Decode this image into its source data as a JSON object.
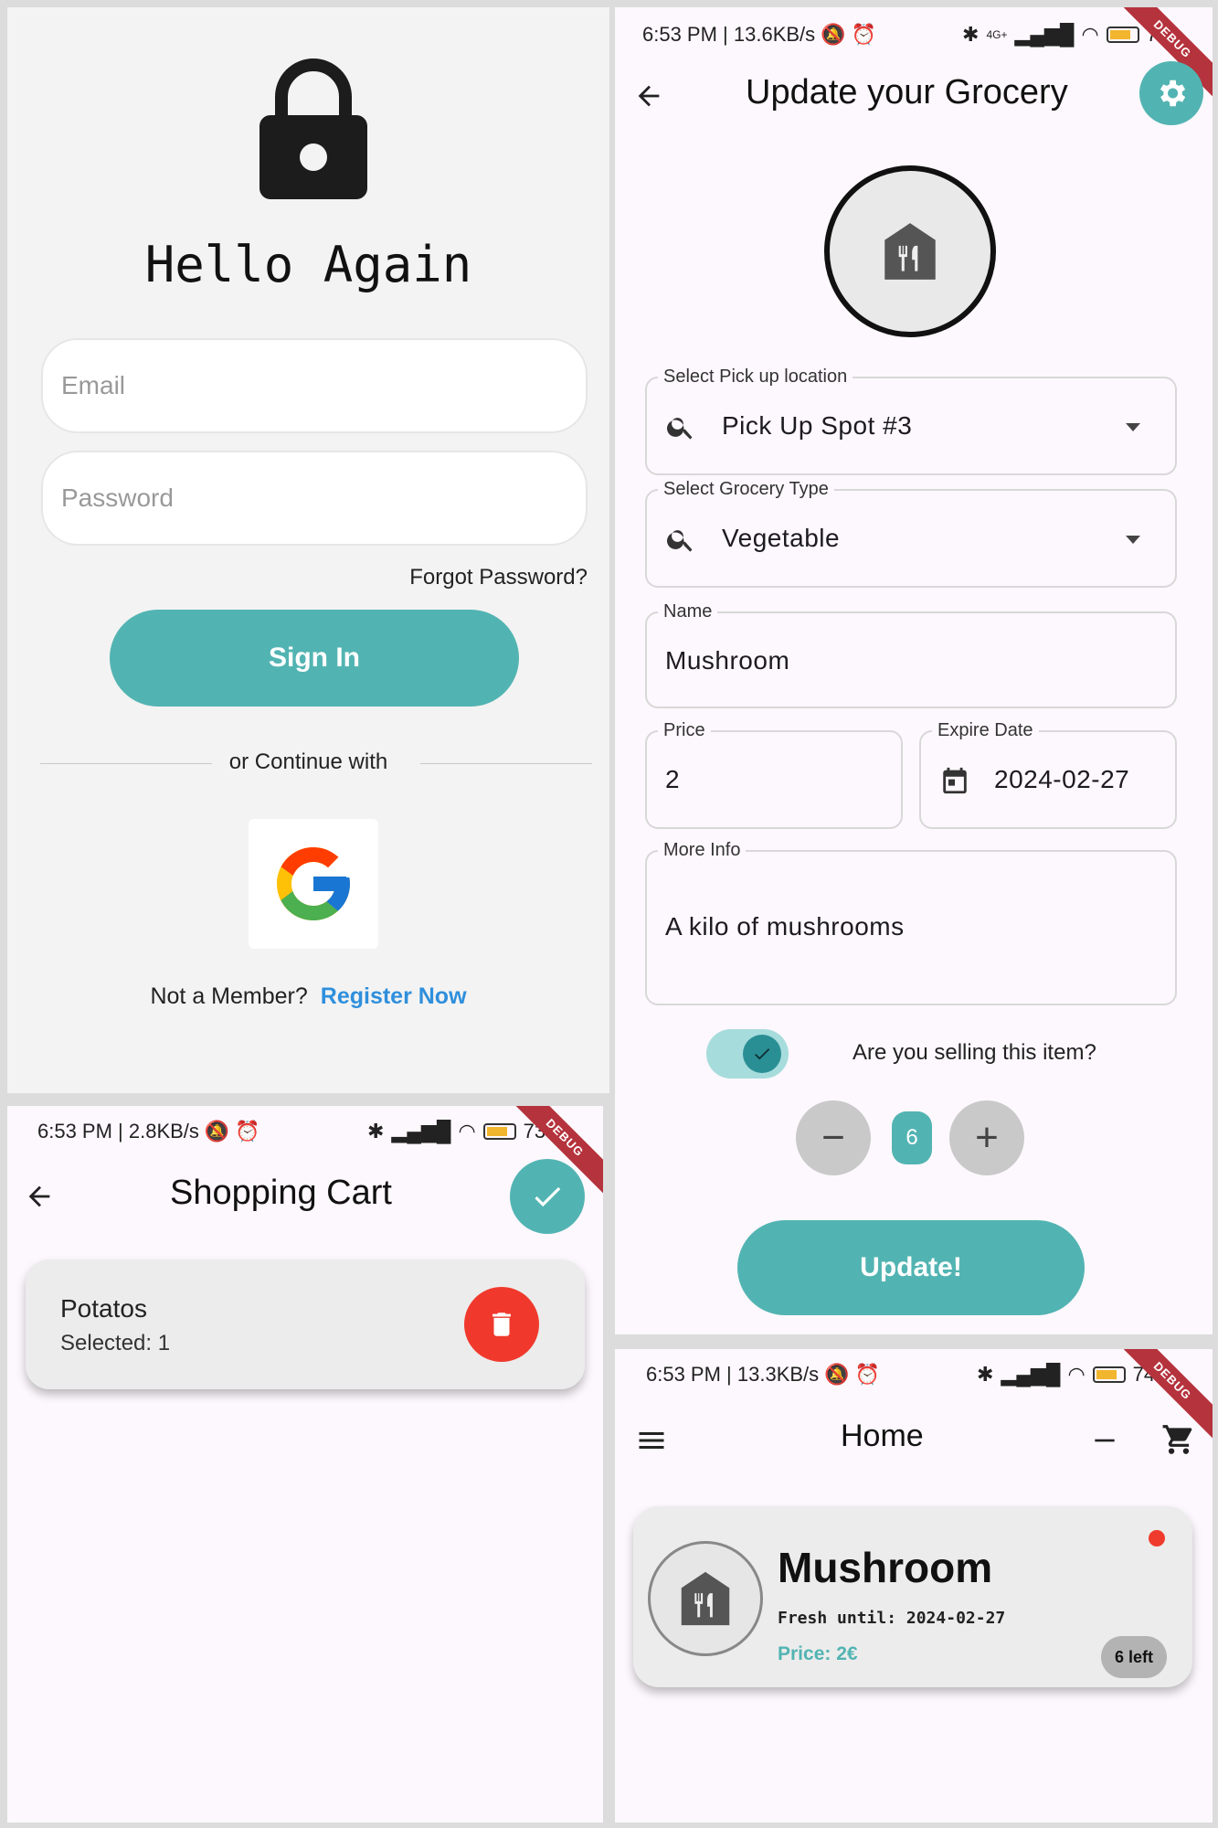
{
  "login": {
    "title": "Hello Again",
    "email_placeholder": "Email",
    "password_placeholder": "Password",
    "forgot": "Forgot Password?",
    "signin": "Sign In",
    "or_continue": "or Continue with",
    "not_member": "Not a Member?",
    "register": "Register Now"
  },
  "update": {
    "status": {
      "time_speed": "6:53 PM | 13.6KB/s",
      "battery": "74",
      "network": "4G+",
      "debug": "DEBUG"
    },
    "title": "Update your Grocery",
    "pickup": {
      "label": "Select Pick up location",
      "value": "Pick Up Spot #3"
    },
    "type": {
      "label": "Select Grocery Type",
      "value": "Vegetable"
    },
    "name": {
      "label": "Name",
      "value": "Mushroom"
    },
    "price": {
      "label": "Price",
      "value": "2"
    },
    "expire": {
      "label": "Expire Date",
      "value": "2024-02-27"
    },
    "info": {
      "label": "More Info",
      "value": "A kilo of mushrooms"
    },
    "selling_question": "Are you selling this item?",
    "selling": true,
    "quantity": "6",
    "minus": "−",
    "plus": "+",
    "update_button": "Update!"
  },
  "cart": {
    "status": {
      "time_speed": "6:53 PM | 2.8KB/s",
      "battery": "73",
      "debug": "DEBUG"
    },
    "title": "Shopping Cart",
    "items": [
      {
        "name": "Potatos",
        "selected": "Selected: 1"
      }
    ]
  },
  "home": {
    "status": {
      "time_speed": "6:53 PM | 13.3KB/s",
      "battery": "74",
      "debug": "DEBUG"
    },
    "title": "Home",
    "card": {
      "name": "Mushroom",
      "fresh": "Fresh until: 2024-02-27",
      "price": "Price: 2€",
      "left": "6 left"
    }
  },
  "colors": {
    "accent": "#52b4b2",
    "danger": "#f0392c",
    "link": "#2f8fdc"
  }
}
